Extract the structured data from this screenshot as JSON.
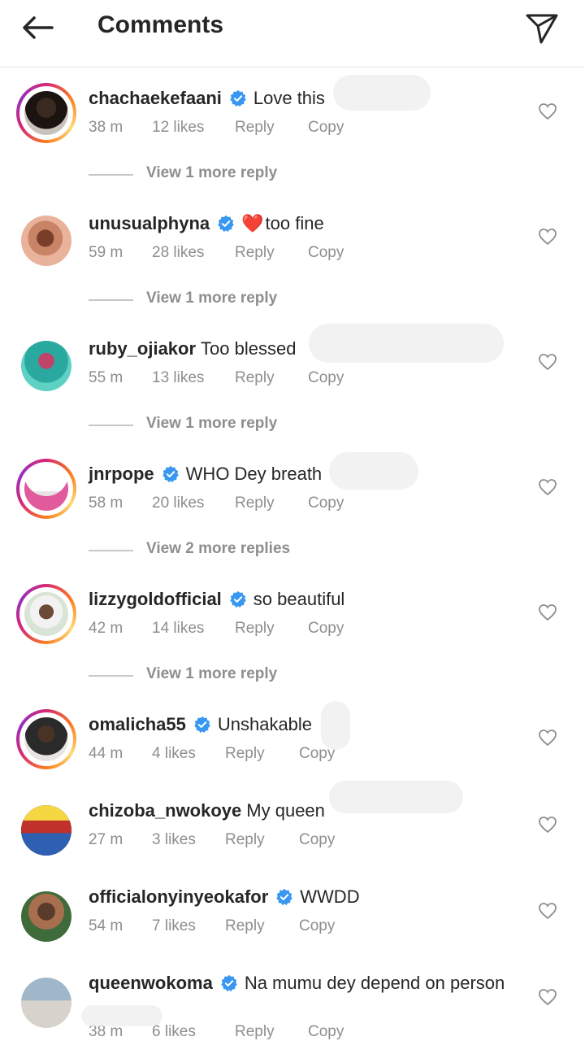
{
  "header": {
    "title": "Comments",
    "back_icon": "arrow-left-icon",
    "send_icon": "paper-plane-icon"
  },
  "comments": [
    {
      "user": "chachaekefaani",
      "verified": true,
      "text": "Love this",
      "time": "38 m",
      "likes": "12 likes",
      "reply": "Reply",
      "copy": "Copy",
      "more": "View 1 more reply",
      "story_ring": true
    },
    {
      "user": "unusualphyna",
      "verified": true,
      "emoji": "❤️",
      "text": "too fine",
      "time": "59 m",
      "likes": "28 likes",
      "reply": "Reply",
      "copy": "Copy",
      "more": "View 1 more reply",
      "story_ring": false
    },
    {
      "user": "ruby_ojiakor",
      "verified": false,
      "text": "Too blessed",
      "time": "55 m",
      "likes": "13 likes",
      "reply": "Reply",
      "copy": "Copy",
      "more": "View 1 more reply",
      "story_ring": false
    },
    {
      "user": "jnrpope",
      "verified": true,
      "text": "WHO Dey breath",
      "time": "58 m",
      "likes": "20 likes",
      "reply": "Reply",
      "copy": "Copy",
      "more": "View 2 more replies",
      "story_ring": true
    },
    {
      "user": "lizzygoldofficial",
      "verified": true,
      "text": "so beautiful",
      "time": "42 m",
      "likes": "14 likes",
      "reply": "Reply",
      "copy": "Copy",
      "more": "View 1 more reply",
      "story_ring": true
    },
    {
      "user": "omalicha55",
      "verified": true,
      "text": "Unshakable",
      "time": "44 m",
      "likes": "4 likes",
      "reply": "Reply",
      "copy": "Copy",
      "story_ring": true
    },
    {
      "user": "chizoba_nwokoye",
      "verified": false,
      "text": "My queen",
      "time": "27 m",
      "likes": "3 likes",
      "reply": "Reply",
      "copy": "Copy",
      "story_ring": false
    },
    {
      "user": "officialonyinyeokafor",
      "verified": true,
      "text": "WWDD",
      "time": "54 m",
      "likes": "7 likes",
      "reply": "Reply",
      "copy": "Copy",
      "story_ring": false
    },
    {
      "user": "queenwokoma",
      "verified": true,
      "text": "Na mumu dey depend on person",
      "time": "38 m",
      "likes": "6 likes",
      "reply": "Reply",
      "copy": "Copy",
      "story_ring": false
    }
  ],
  "colors": {
    "verified": "#3897f0",
    "muted": "#8e8e8e",
    "text": "#262626"
  }
}
